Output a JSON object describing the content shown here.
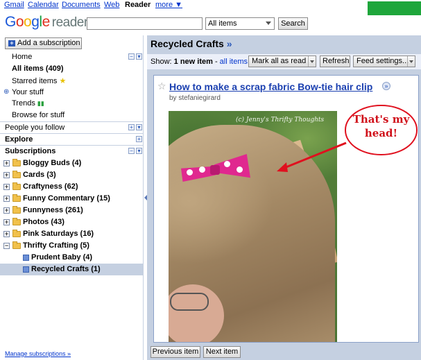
{
  "topnav": {
    "links": [
      "Gmail",
      "Calendar",
      "Documents",
      "Web"
    ],
    "current": "Reader",
    "more": "more ▼"
  },
  "logo": {
    "google": "Google",
    "product": "reader"
  },
  "search": {
    "scope": "All items",
    "button": "Search",
    "value": ""
  },
  "sidebar": {
    "add_subscription": "Add a subscription",
    "nav": [
      "Home",
      "All items (409)",
      "Starred items",
      "Your stuff",
      "Trends",
      "Browse for stuff"
    ],
    "people": "People you follow",
    "explore": "Explore",
    "subscriptions": "Subscriptions",
    "folders": [
      "Bloggy Buds (4)",
      "Cards (3)",
      "Craftyness (62)",
      "Funny Commentary (15)",
      "Funnyness (261)",
      "Photos (43)",
      "Pink Saturdays (16)",
      "Thrifty Crafting (5)"
    ],
    "feeds": [
      "Prudent Baby (4)",
      "Recycled Crafts (1)"
    ],
    "manage": "Manage subscriptions »"
  },
  "main": {
    "title": "Recycled Crafts",
    "title_suffix": "»",
    "show_label": "Show:",
    "new_items": "1 new item",
    "separator": " - ",
    "all_items": "all items",
    "mark_all": "Mark all as read",
    "refresh": "Refresh",
    "feed_settings": "Feed settings...",
    "entry": {
      "title": "How to make a scrap fabric Bow-tie hair clip",
      "byline": "by stefaniegirard",
      "watermark": "(c) Jenny's Thrifty Thoughts",
      "annotation": "That's my head!"
    },
    "prev": "Previous item",
    "next": "Next item"
  },
  "colors": {
    "accent": "#c5d0e1",
    "link": "#0033cc",
    "annotation": "#d0101a"
  }
}
